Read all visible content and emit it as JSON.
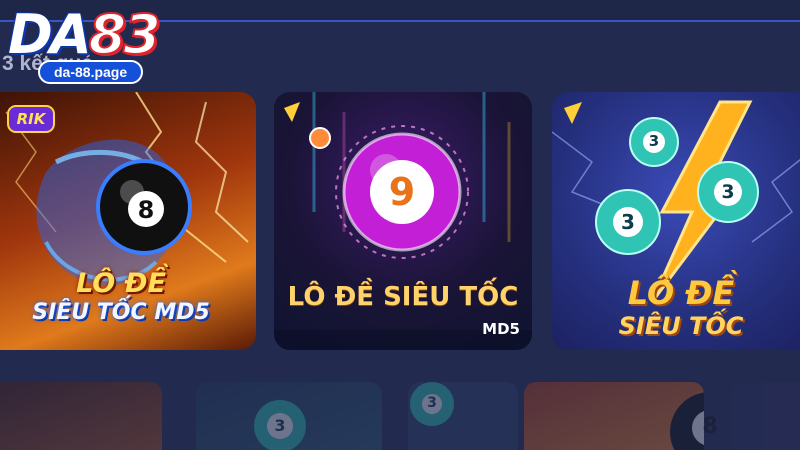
{
  "logo": {
    "brand_da": "DA",
    "brand_num": "83",
    "domain": "da-88.page"
  },
  "section": {
    "title": "3 kết quả"
  },
  "games": [
    {
      "badge": "RIK",
      "ball_number": "8",
      "title_line1": "LÔ ĐỀ",
      "title_line2": "SIÊU TỐC MD5"
    },
    {
      "ball_number": "9",
      "title_line1": "LÔ ĐỀ SIÊU TỐC",
      "title_line2": "MD5"
    },
    {
      "ball_number_a": "3",
      "ball_number_b": "3",
      "ball_number_c": "3",
      "title_line1": "LÔ ĐỀ",
      "title_line2": "SIÊU TỐC"
    }
  ],
  "bottom": {
    "ball_a": "3",
    "ball_b": "3",
    "ball_c": "8"
  },
  "colors": {
    "background": "#222a50",
    "accent": "#3a55c8",
    "logo_red": "#e0242c",
    "logo_blue": "#1550d8"
  }
}
